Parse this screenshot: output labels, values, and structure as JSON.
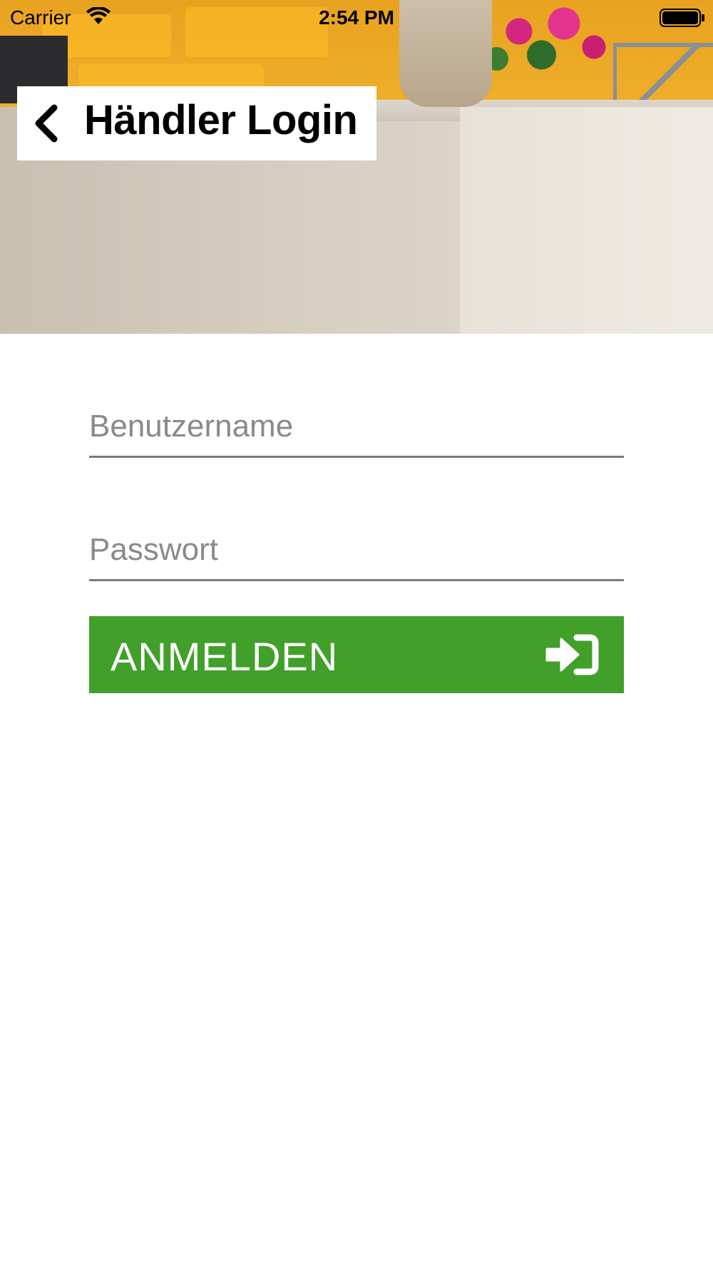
{
  "status_bar": {
    "carrier": "Carrier",
    "time": "2:54 PM",
    "wifi_icon": "wifi-icon",
    "battery_icon": "battery-icon"
  },
  "header": {
    "title": "Händler Login",
    "back_icon": "chevron-left-icon"
  },
  "form": {
    "username_placeholder": "Benutzername",
    "username_value": "",
    "password_placeholder": "Passwort",
    "password_value": "",
    "submit_label": "ANMELDEN",
    "submit_icon": "sign-in-icon"
  },
  "colors": {
    "accent": "#41a02a",
    "underline": "#7a7a7a",
    "placeholder": "#8a8a8a"
  }
}
